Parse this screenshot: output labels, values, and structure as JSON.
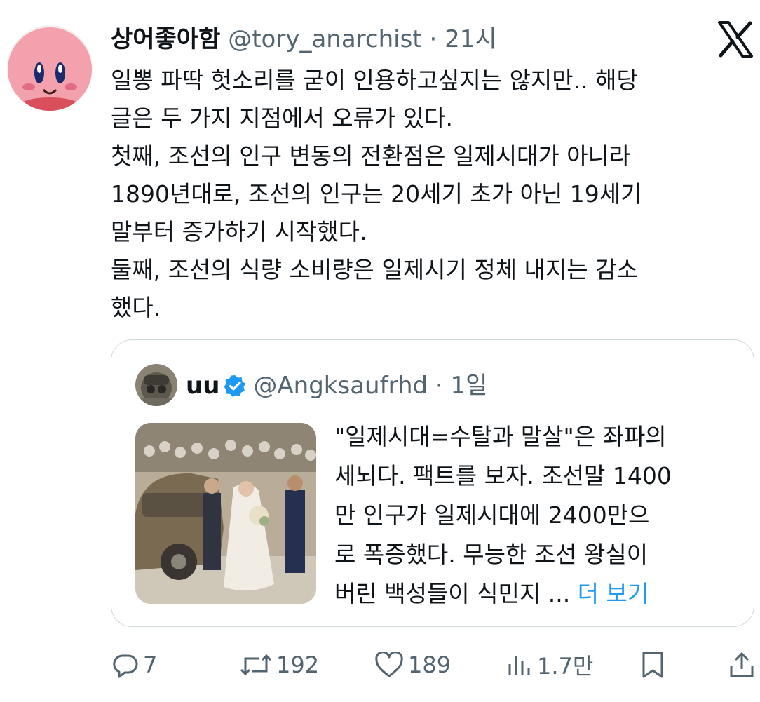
{
  "post": {
    "author_name": "상어좋아함",
    "handle": "@tory_anarchist",
    "separator": " · ",
    "time": "21시",
    "lines": [
      "일뽕 파딱 헛소리를 굳이 인용하고싶지는 않지만.. 해당",
      "글은 두 가지 지점에서 오류가 있다.",
      "첫째, 조선의 인구 변동의 전환점은 일제시대가 아니라",
      "1890년대로, 조선의 인구는 20세기 초가 아닌 19세기",
      "말부터 증가하기 시작했다.",
      "둘째, 조선의 식량 소비량은 일제시기 정체 내지는 감소",
      "했다."
    ]
  },
  "quote": {
    "author_name": "uu",
    "handle": "@Angksaufrhd",
    "separator": " · ",
    "time": "1일",
    "lines": [
      "\"일제시대=수탈과 말살\"은 좌파의",
      "세뇌다. 팩트를 보자. 조선말 1400",
      "만 인구가 일제시대에 2400만으",
      "로 폭증했다. 무능한 조선 왕실이"
    ],
    "last_line": "버린 백성들이 식민지 ... ",
    "more_label": "더 보기"
  },
  "actions": {
    "replies": "7",
    "reposts": "192",
    "likes": "189",
    "views": "1.7만"
  },
  "icons": {
    "platform": "x-logo-icon",
    "verified": "verified-badge-icon",
    "reply": "reply-icon",
    "repost": "repost-icon",
    "like": "heart-icon",
    "views": "views-icon",
    "bookmark": "bookmark-icon",
    "share": "share-icon"
  },
  "colors": {
    "text": "#0f1419",
    "secondary": "#536471",
    "link": "#1d9bf0",
    "border": "#cfd9de",
    "avatar_pink": "#f2a1ad"
  }
}
